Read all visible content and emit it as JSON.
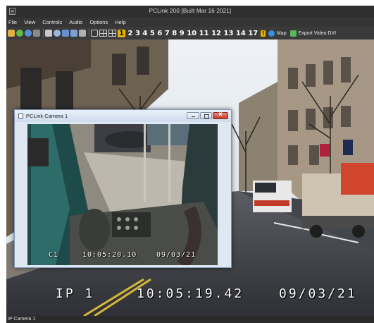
{
  "window": {
    "title": "PCLink 200 [Built Mar 16 2021]"
  },
  "menu": [
    "File",
    "View",
    "Controls",
    "Audio",
    "Options",
    "Help"
  ],
  "toolbar": {
    "icons": [
      {
        "name": "folder-open-icon",
        "color": "#e0b040"
      },
      {
        "name": "play-green-icon",
        "color": "#5bbd4e"
      },
      {
        "name": "globe-icon",
        "color": "#5a8fd8"
      },
      {
        "name": "disk-icon",
        "color": "#8a8a8a"
      },
      {
        "name": "copy-icon",
        "color": "#c8c8c8"
      },
      {
        "name": "search-icon",
        "color": "#9ab8e0"
      },
      {
        "name": "save-icon",
        "color": "#6a8ed0"
      },
      {
        "name": "export-icon",
        "color": "#7aa0d8"
      },
      {
        "name": "print-icon",
        "color": "#b0b0b0"
      }
    ],
    "camera_numbers": [
      "1",
      "2",
      "3",
      "4",
      "5",
      "6",
      "7",
      "8",
      "9",
      "10",
      "11",
      "12",
      "13",
      "14",
      "17"
    ],
    "active_camera": "1",
    "map_label": "Map",
    "export_label": "Export Video DVI"
  },
  "main_osd": {
    "channel": "IP 1",
    "time": "10:05:19.42",
    "date": "09/03/21"
  },
  "child_window": {
    "title": "PCLink Camera 1",
    "osd": {
      "channel": "C1",
      "time": "10:05:20.10",
      "date": "09/03/21"
    }
  },
  "status": {
    "text": "IP Camera 1"
  },
  "colors": {
    "active_camera_highlight": "#e8b400",
    "child_close_button": "#c4382a"
  }
}
